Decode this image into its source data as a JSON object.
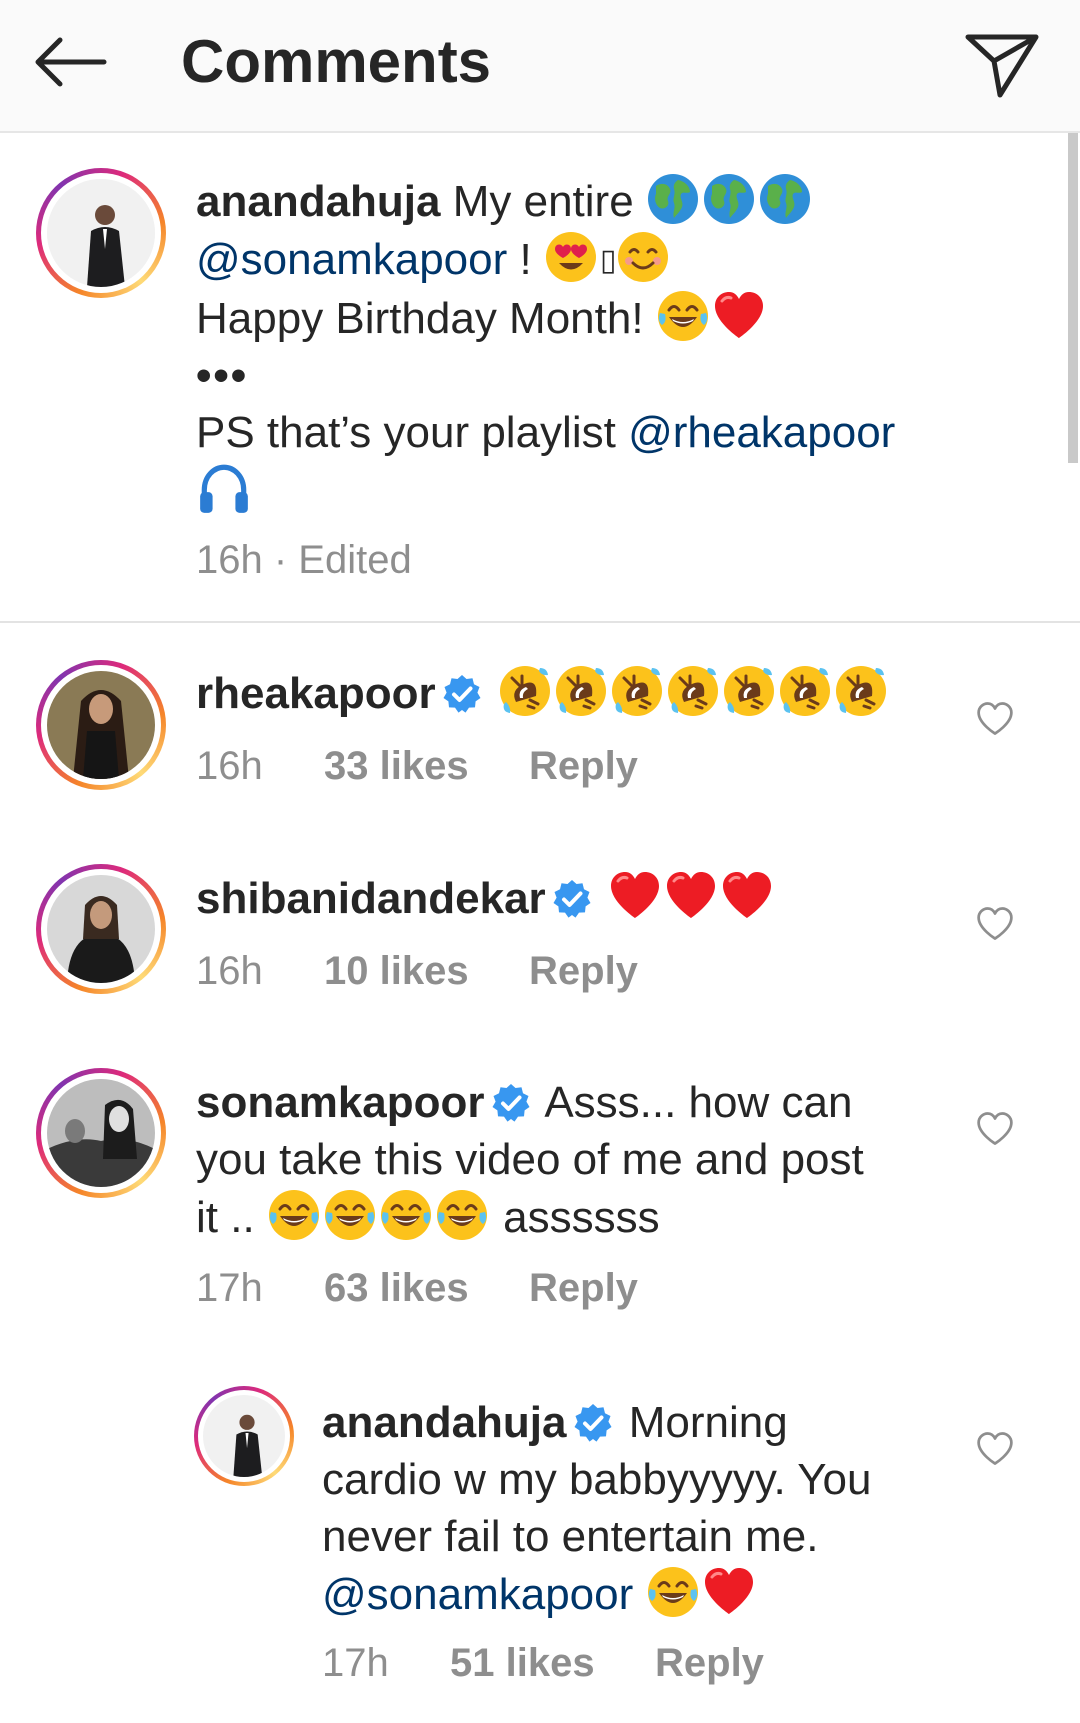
{
  "header": {
    "title": "Comments",
    "back_icon": "arrow-left-icon",
    "share_icon": "paper-plane-icon"
  },
  "caption": {
    "username": "anandahuja",
    "line1_text": " My entire ",
    "mention1": "@sonamkapoor",
    "line2_text": " ! ",
    "missing_glyph": "▯",
    "line3_text": "Happy Birthday Month! ",
    "ellipsis": "•••",
    "line5_text": "PS that’s your playlist ",
    "mention2": "@rheakapoor",
    "time": "16h",
    "separator": " · ",
    "edited": "Edited"
  },
  "comments": [
    {
      "username": "rheakapoor",
      "verified": true,
      "time": "16h",
      "likes": "33 likes",
      "reply": "Reply"
    },
    {
      "username": "shibanidandekar",
      "verified": true,
      "time": "16h",
      "likes": "10 likes",
      "reply": "Reply"
    },
    {
      "username": "sonamkapoor",
      "verified": true,
      "text_line1": " Asss... how can",
      "text_line2": "you take this video of me and post",
      "text_line3_a": "it .. ",
      "text_line3_b": " assssss",
      "time": "17h",
      "likes": "63 likes",
      "reply": "Reply"
    }
  ],
  "reply": {
    "username": "anandahuja",
    "verified": true,
    "text_line1": " Morning",
    "text_line2": "cardio w my babbyyyyy. You",
    "text_line3": "never fail to entertain me.",
    "mention": "@sonamkapoor",
    "time": "17h",
    "likes": "51 likes",
    "reply": "Reply"
  },
  "colors": {
    "text": "#262626",
    "secondary": "#8e8e8e",
    "mention": "#003569",
    "verified": "#3897f0",
    "heart_red": "#ed1c24",
    "header_bg": "#fafafa"
  }
}
